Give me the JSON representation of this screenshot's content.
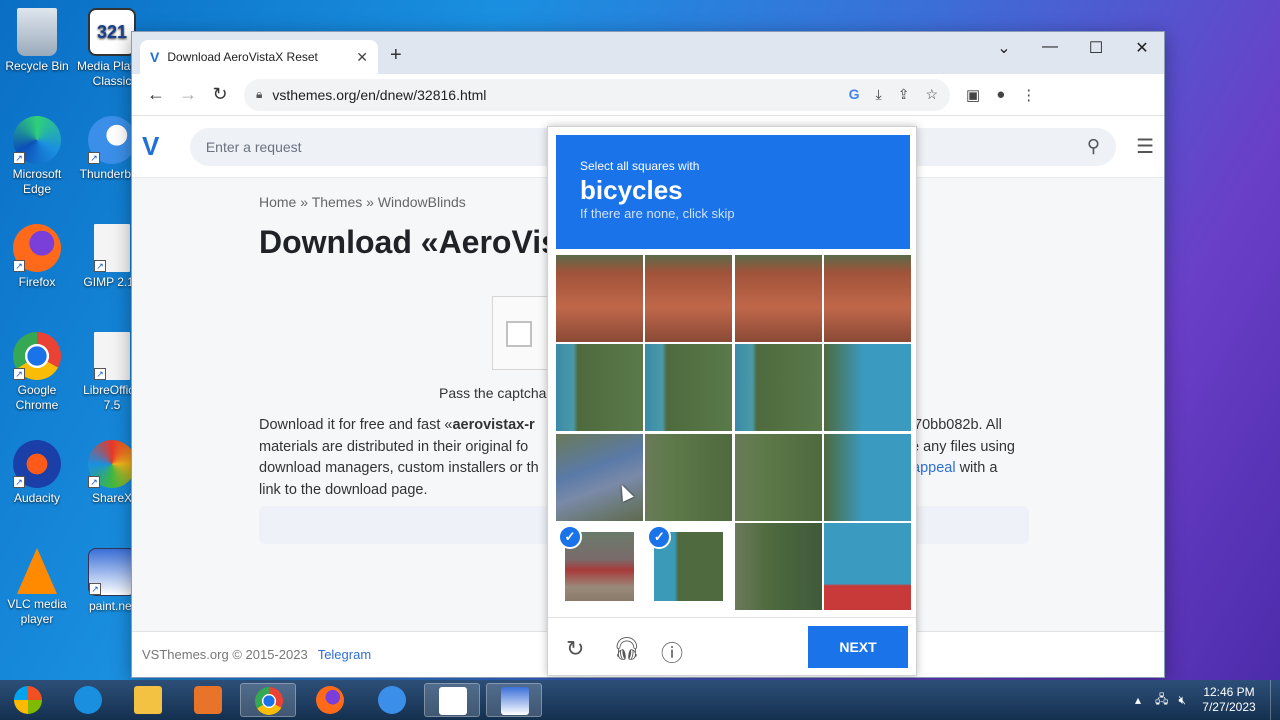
{
  "desktop": {
    "icons": [
      {
        "label": "Recycle Bin",
        "icon": "recycle-bin-icon"
      },
      {
        "label": "Media Player Classic",
        "icon": "media-player-icon"
      },
      {
        "label": "Microsoft Edge",
        "icon": "edge-icon"
      },
      {
        "label": "Thunderbird",
        "icon": "thunderbird-icon"
      },
      {
        "label": "Firefox",
        "icon": "firefox-icon"
      },
      {
        "label": "GIMP 2.10",
        "icon": "gimp-icon"
      },
      {
        "label": "Google Chrome",
        "icon": "chrome-icon"
      },
      {
        "label": "LibreOffice 7.5",
        "icon": "libreoffice-icon"
      },
      {
        "label": "Audacity",
        "icon": "audacity-icon"
      },
      {
        "label": "ShareX",
        "icon": "sharex-icon"
      },
      {
        "label": "VLC media player",
        "icon": "vlc-icon"
      },
      {
        "label": "paint.net",
        "icon": "paintnet-icon"
      }
    ]
  },
  "browser": {
    "tab_title": "Download AeroVistaX Reset",
    "url": "vsthemes.org/en/dnew/32816.html"
  },
  "site": {
    "search_placeholder": "Enter a request",
    "breadcrumb": [
      "Home",
      "Themes",
      "WindowBlinds"
    ],
    "breadcrumb_sep": "»",
    "title": "Download «AeroVist",
    "pass_text": "Pass the captcha",
    "desc": {
      "line1_a": "Download it for free and fast «",
      "line1_b": "aerovistax-r",
      "line1_c": "70bb082b. All",
      "line2_a": "materials are distributed in their original fo",
      "line2_c": "e any files using",
      "line3_a": "download managers, custom installers or th",
      "line3_link": "appeal",
      "line3_c": "with a",
      "line4": "link to the download page."
    },
    "footer_copyright": "VSThemes.org © 2015-2023",
    "footer_link": "Telegram"
  },
  "captcha": {
    "instruction": "Select all squares with",
    "target": "bicycles",
    "hint": "If there are none, click skip",
    "selected_cells": [
      12,
      13
    ],
    "next_label": "NEXT",
    "accent": "#1a73e8"
  },
  "taskbar": {
    "time": "12:46 PM",
    "date": "7/27/2023"
  }
}
